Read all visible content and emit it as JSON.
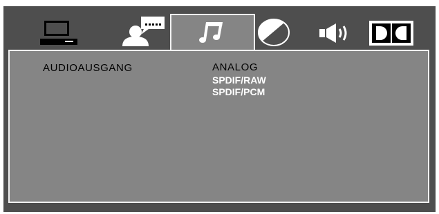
{
  "colors": {
    "frame": "#4e4e4e",
    "panel": "#858585",
    "border": "#f2f2f2",
    "icon_light": "#ffffff",
    "icon_dark": "#000000"
  },
  "tabs": [
    {
      "icon": "tv-monitor-icon"
    },
    {
      "icon": "user-message-icon"
    },
    {
      "icon": "music-note-icon",
      "active": true
    },
    {
      "icon": "contrast-circle-icon"
    },
    {
      "icon": "speaker-icon"
    },
    {
      "icon": "dolby-digital-icon"
    }
  ],
  "setting": {
    "label": "AUDIOAUSGANG",
    "current_option": "ANALOG",
    "options": [
      "SPDIF/RAW",
      "SPDIF/PCM"
    ]
  }
}
